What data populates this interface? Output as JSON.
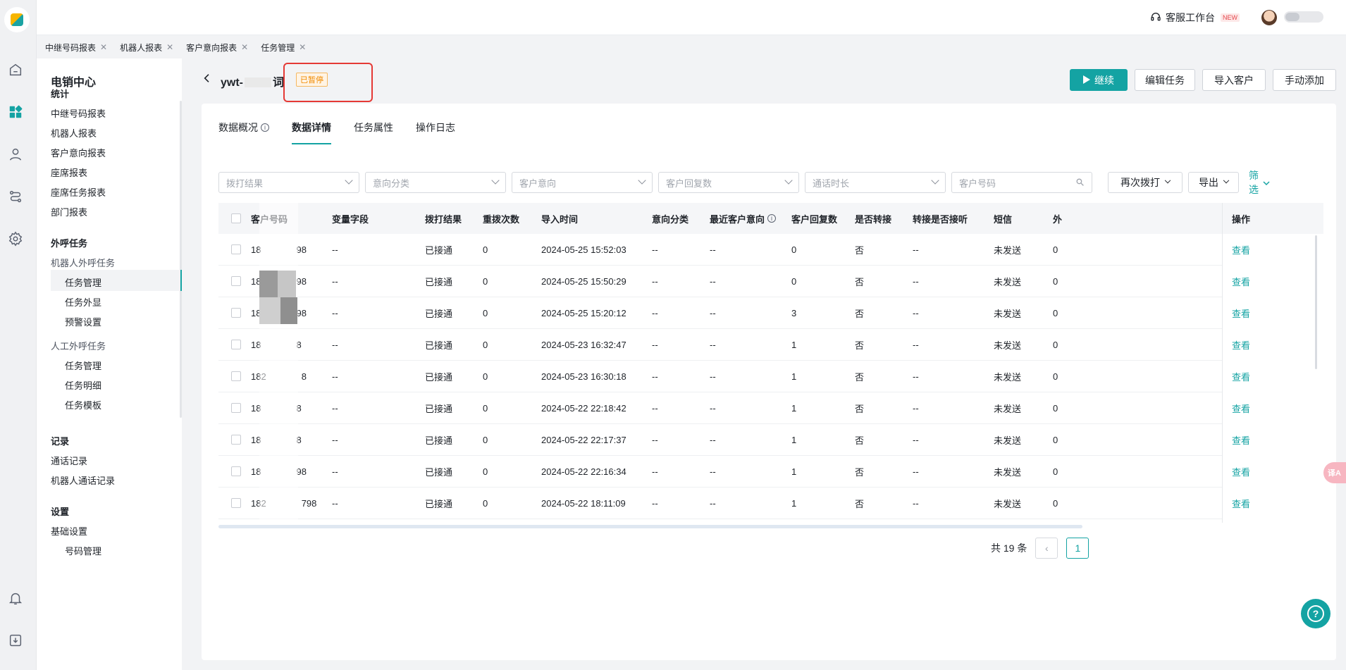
{
  "topbar": {
    "kefu_label": "客服工作台",
    "kefu_new": "NEW"
  },
  "page_tabs": [
    {
      "label": "中继号码报表"
    },
    {
      "label": "机器人报表"
    },
    {
      "label": "客户意向报表"
    },
    {
      "label": "任务管理"
    }
  ],
  "sidebar": {
    "title": "电销中心",
    "stats_title": "统计",
    "stats": [
      "中继号码报表",
      "机器人报表",
      "客户意向报表",
      "座席报表",
      "座席任务报表",
      "部门报表"
    ],
    "outbound_title": "外呼任务",
    "robot_group": "机器人外呼任务",
    "robot_items": [
      "任务管理",
      "任务外显",
      "预警设置"
    ],
    "manual_group": "人工外呼任务",
    "manual_items": [
      "任务管理",
      "任务明细",
      "任务模板"
    ],
    "records_title": "记录",
    "records": [
      "通话记录",
      "机器人通话记录"
    ],
    "settings_title": "设置",
    "settings": [
      "基础设置",
      "号码管理"
    ]
  },
  "header": {
    "title": "ywt-",
    "title_tail": "词",
    "status_badge": "已暂停",
    "continue_label": "继续",
    "edit_label": "编辑任务",
    "import_label": "导入客户",
    "manual_add_label": "手动添加"
  },
  "content_tabs": [
    "数据概况",
    "数据详情",
    "任务属性",
    "操作日志"
  ],
  "filters": {
    "dial_result": "拨打结果",
    "intent_category": "意向分类",
    "customer_intent": "客户意向",
    "reply_count": "客户回复数",
    "call_duration": "通话时长",
    "phone_placeholder": "客户号码",
    "redial": "再次拨打",
    "export": "导出",
    "filter": "筛选"
  },
  "table": {
    "headers": [
      "客户号码",
      "变量字段",
      "拨打结果",
      "重拨次数",
      "导入时间",
      "意向分类",
      "最近客户意向",
      "客户回复数",
      "是否转接",
      "转接是否接听",
      "短信",
      "操作"
    ],
    "rows": [
      {
        "phone": "18",
        "phone_tail": "98",
        "var": "--",
        "result": "已接通",
        "redial": "0",
        "time": "2024-05-25 15:52:03",
        "cat": "--",
        "intent": "--",
        "replies": "0",
        "transfer": "否",
        "answered": "--",
        "sms": "未发送",
        "extra": "0",
        "action": "查看"
      },
      {
        "phone": "18",
        "phone_tail": "98",
        "var": "--",
        "result": "已接通",
        "redial": "0",
        "time": "2024-05-25 15:50:29",
        "cat": "--",
        "intent": "--",
        "replies": "0",
        "transfer": "否",
        "answered": "--",
        "sms": "未发送",
        "extra": "0",
        "action": "查看"
      },
      {
        "phone": "18",
        "phone_tail": "98",
        "var": "--",
        "result": "已接通",
        "redial": "0",
        "time": "2024-05-25 15:20:12",
        "cat": "--",
        "intent": "--",
        "replies": "3",
        "transfer": "否",
        "answered": "--",
        "sms": "未发送",
        "extra": "0",
        "action": "查看"
      },
      {
        "phone": "18",
        "phone_tail": "8",
        "var": "--",
        "result": "已接通",
        "redial": "0",
        "time": "2024-05-23 16:32:47",
        "cat": "--",
        "intent": "--",
        "replies": "1",
        "transfer": "否",
        "answered": "--",
        "sms": "未发送",
        "extra": "0",
        "action": "查看"
      },
      {
        "phone": "182",
        "phone_tail": "8",
        "var": "--",
        "result": "已接通",
        "redial": "0",
        "time": "2024-05-23 16:30:18",
        "cat": "--",
        "intent": "--",
        "replies": "1",
        "transfer": "否",
        "answered": "--",
        "sms": "未发送",
        "extra": "0",
        "action": "查看"
      },
      {
        "phone": "18",
        "phone_tail": "8",
        "var": "--",
        "result": "已接通",
        "redial": "0",
        "time": "2024-05-22 22:18:42",
        "cat": "--",
        "intent": "--",
        "replies": "1",
        "transfer": "否",
        "answered": "--",
        "sms": "未发送",
        "extra": "0",
        "action": "查看"
      },
      {
        "phone": "18",
        "phone_tail": "8",
        "var": "--",
        "result": "已接通",
        "redial": "0",
        "time": "2024-05-22 22:17:37",
        "cat": "--",
        "intent": "--",
        "replies": "1",
        "transfer": "否",
        "answered": "--",
        "sms": "未发送",
        "extra": "0",
        "action": "查看"
      },
      {
        "phone": "18",
        "phone_tail": "98",
        "var": "--",
        "result": "已接通",
        "redial": "0",
        "time": "2024-05-22 22:16:34",
        "cat": "--",
        "intent": "--",
        "replies": "1",
        "transfer": "否",
        "answered": "--",
        "sms": "未发送",
        "extra": "0",
        "action": "查看"
      },
      {
        "phone": "182",
        "phone_tail": "798",
        "var": "--",
        "result": "已接通",
        "redial": "0",
        "time": "2024-05-22 18:11:09",
        "cat": "--",
        "intent": "--",
        "replies": "1",
        "transfer": "否",
        "answered": "--",
        "sms": "未发送",
        "extra": "0",
        "action": "查看"
      }
    ]
  },
  "pagination": {
    "total": "共 19 条",
    "page": "1"
  },
  "colors": {
    "accent": "#14a3a3",
    "paused": "#f08a00",
    "highlight": "#e53935"
  }
}
